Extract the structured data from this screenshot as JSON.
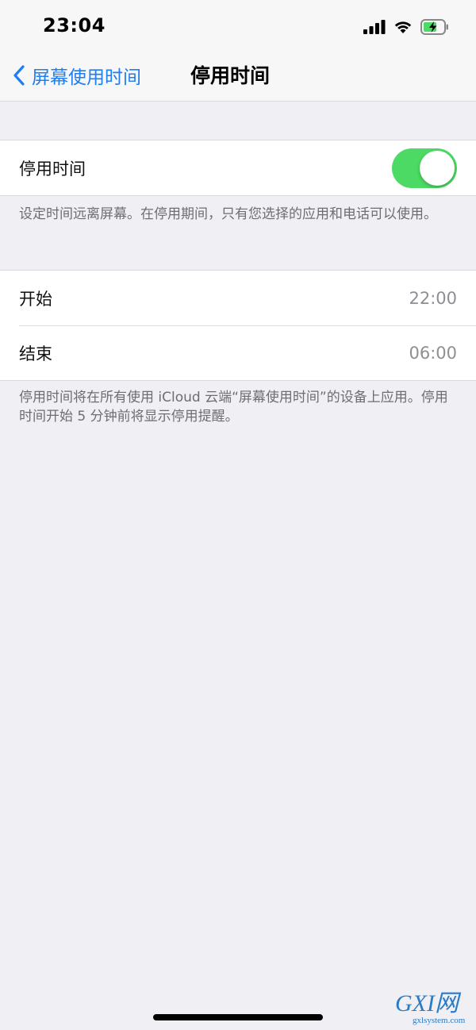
{
  "status_bar": {
    "time": "23:04",
    "icons": [
      "cellular-signal-icon",
      "wifi-icon",
      "battery-charging-icon"
    ]
  },
  "nav": {
    "back_label": "屏幕使用时间",
    "title": "停用时间"
  },
  "downtime_toggle": {
    "label": "停用时间",
    "enabled": true
  },
  "toggle_footnote": "设定时间远离屏幕。在停用期间，只有您选择的应用和电话可以使用。",
  "schedule": {
    "start_label": "开始",
    "start_value": "22:00",
    "end_label": "结束",
    "end_value": "06:00"
  },
  "schedule_footnote": "停用时间将在所有使用 iCloud 云端“屏幕使用时间”的设备上应用。停用时间开始 5 分钟前将显示停用提醒。",
  "watermark": {
    "logo_text": "GXI网",
    "url": "gxlsystem.com"
  },
  "colors": {
    "accent": "#1f7ef0",
    "toggle_on": "#4cd964",
    "background": "#efeff4",
    "secondary_text": "#8e8e93"
  }
}
